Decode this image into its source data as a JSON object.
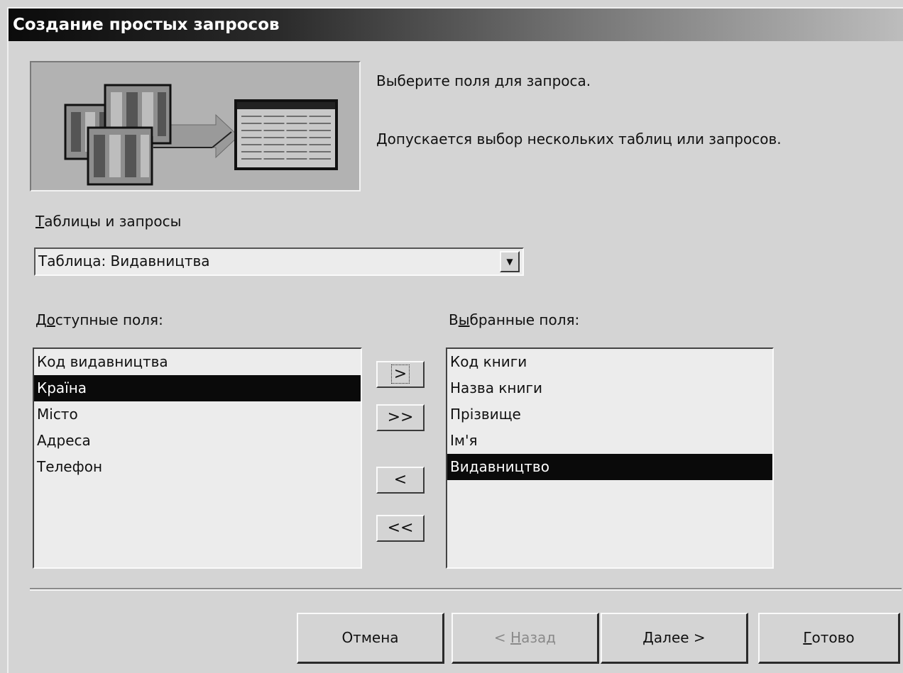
{
  "window": {
    "title": "Создание простых запросов"
  },
  "info": {
    "line1": "Выберите поля для запроса.",
    "line2": "Допускается выбор нескольких таблиц или запросов."
  },
  "tables": {
    "label_access_key": "Т",
    "label_rest": "аблицы и запросы",
    "selected": "Таблица: Видавництва"
  },
  "available": {
    "label_pre": "Д",
    "label_key": "о",
    "label_post": "ступные поля:",
    "items": [
      "Код видавництва",
      "Країна",
      "Місто",
      "Адреса",
      "Телефон"
    ]
  },
  "selected_fields": {
    "label_pre": "В",
    "label_key": "ы",
    "label_post": "бранные поля:",
    "items": [
      "Код книги",
      "Назва книги",
      "Прізвище",
      "Ім'я",
      "Видавництво"
    ]
  },
  "move": {
    "one": ">",
    "all": ">>",
    "back_one": "<",
    "back_all": "<<"
  },
  "buttons": {
    "cancel": "Отмена",
    "back_pre": "< ",
    "back_key": "Н",
    "back_post": "азад",
    "next_key": "Д",
    "next_post": "алее >",
    "finish_key": "Г",
    "finish_post": "отово"
  }
}
